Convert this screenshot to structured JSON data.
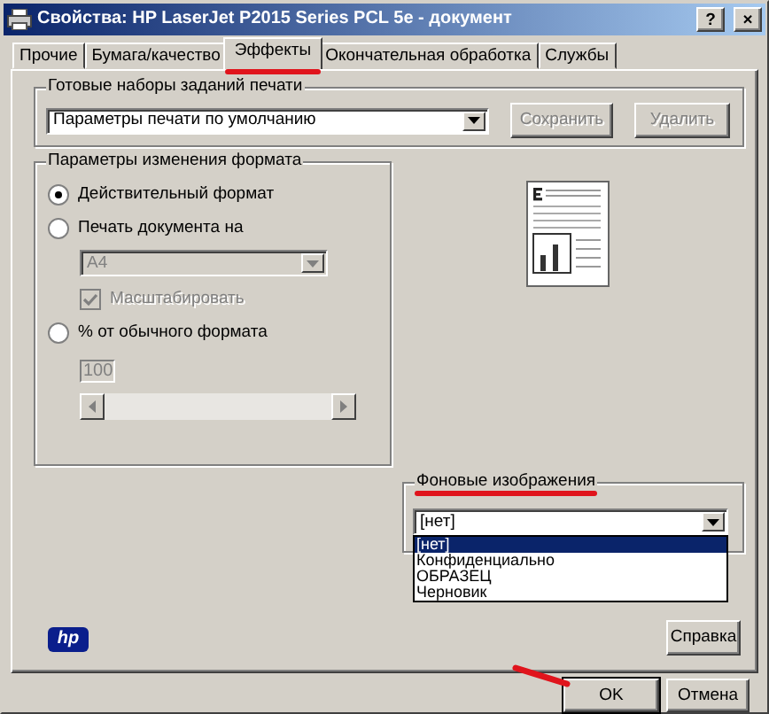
{
  "window": {
    "title": "Свойства: HP LaserJet P2015 Series PCL 5e - документ",
    "controls": [
      {
        "kind": "help",
        "label": "?"
      },
      {
        "kind": "close",
        "label": "×"
      }
    ]
  },
  "tabs": [
    {
      "label": "Прочие",
      "selected": false
    },
    {
      "label": "Бумага/качество",
      "selected": false
    },
    {
      "label": "Эффекты",
      "selected": true
    },
    {
      "label": "Окончательная обработка",
      "selected": false
    },
    {
      "label": "Службы",
      "selected": false
    }
  ],
  "presets": {
    "label": "Готовые наборы заданий печати",
    "value": "Параметры печати по умолчанию",
    "buttons": [
      {
        "label": "Сохранить",
        "disabled": true
      },
      {
        "label": "Удалить",
        "disabled": true
      }
    ]
  },
  "resize": {
    "label": "Параметры изменения формата",
    "options": [
      {
        "kind": "radio",
        "label": "Действительный формат",
        "selected": true
      },
      {
        "kind": "radio",
        "label": "Печать документа на",
        "selected": false
      },
      {
        "kind": "select",
        "value": "A4",
        "disabled": true
      },
      {
        "kind": "checkbox",
        "label": "Масштабировать",
        "checked": true,
        "disabled": true
      },
      {
        "kind": "radio",
        "label": "% от обычного формата",
        "selected": false
      },
      {
        "kind": "field",
        "value": "100",
        "disabled": true
      },
      {
        "kind": "scrollbar",
        "disabled": true
      }
    ]
  },
  "watermarks": {
    "label": "Фоновые изображения",
    "value": "[нет]",
    "expanded": true,
    "options": [
      {
        "label": "[нет]",
        "selected": true
      },
      {
        "label": "Конфиденциально",
        "selected": false
      },
      {
        "label": "ОБРАЗЕЦ",
        "selected": false
      },
      {
        "label": "Черновик",
        "selected": false
      }
    ]
  },
  "logo": "hp",
  "help_button": "Справка",
  "buttons": [
    "OK",
    "Отмена"
  ]
}
